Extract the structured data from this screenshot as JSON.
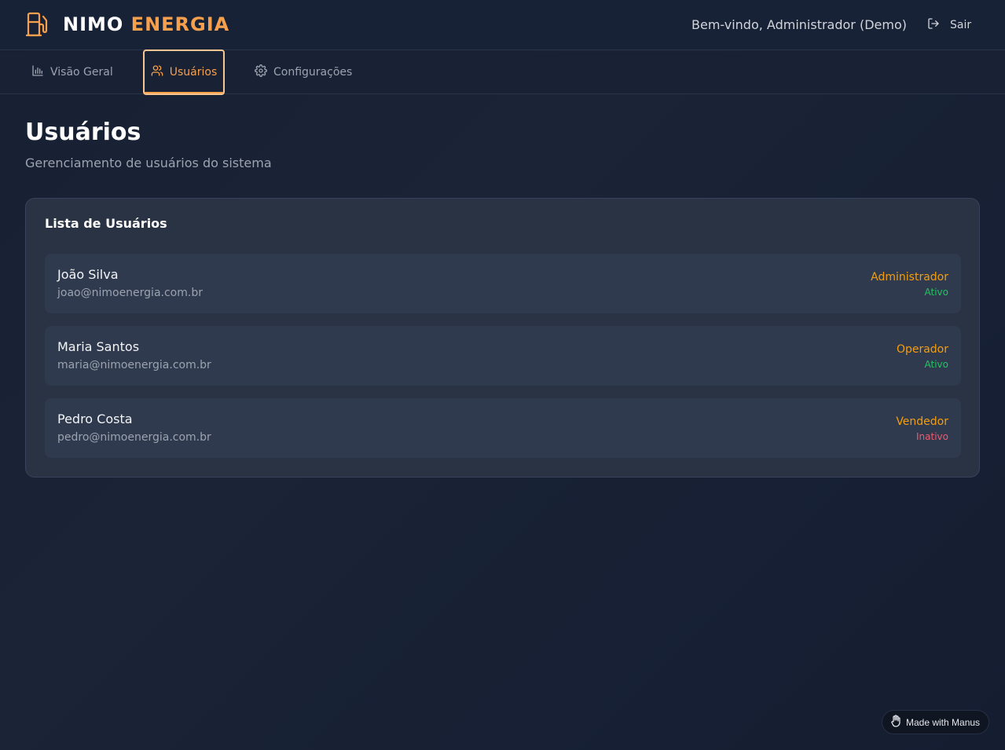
{
  "header": {
    "brand_primary": "NIMO",
    "brand_accent": "ENERGIA",
    "logo_icon": "fuel-pump-icon",
    "welcome_text": "Bem-vindo, Administrador (Demo)",
    "logout_label": "Sair",
    "logout_icon": "logout-icon"
  },
  "tabs": [
    {
      "label": "Visão Geral",
      "icon": "bar-chart-icon",
      "active": false
    },
    {
      "label": "Usuários",
      "icon": "users-icon",
      "active": true
    },
    {
      "label": "Configurações",
      "icon": "gear-icon",
      "active": false
    }
  ],
  "page": {
    "title": "Usuários",
    "subtitle": "Gerenciamento de usuários do sistema"
  },
  "user_list": {
    "title": "Lista de Usuários",
    "users": [
      {
        "name": "João Silva",
        "email": "joao@nimoenergia.com.br",
        "role": "Administrador",
        "status": "Ativo"
      },
      {
        "name": "Maria Santos",
        "email": "maria@nimoenergia.com.br",
        "role": "Operador",
        "status": "Ativo"
      },
      {
        "name": "Pedro Costa",
        "email": "pedro@nimoenergia.com.br",
        "role": "Vendedor",
        "status": "Inativo"
      }
    ]
  },
  "badge": {
    "label": "Made with Manus",
    "icon": "manus-hand-icon"
  },
  "colors": {
    "accent": "#f6a04d",
    "role": "#f59e0b",
    "active": "#22c55e",
    "inactive": "#f05a6e",
    "background": "#1b2436",
    "card": "#2a3343"
  }
}
